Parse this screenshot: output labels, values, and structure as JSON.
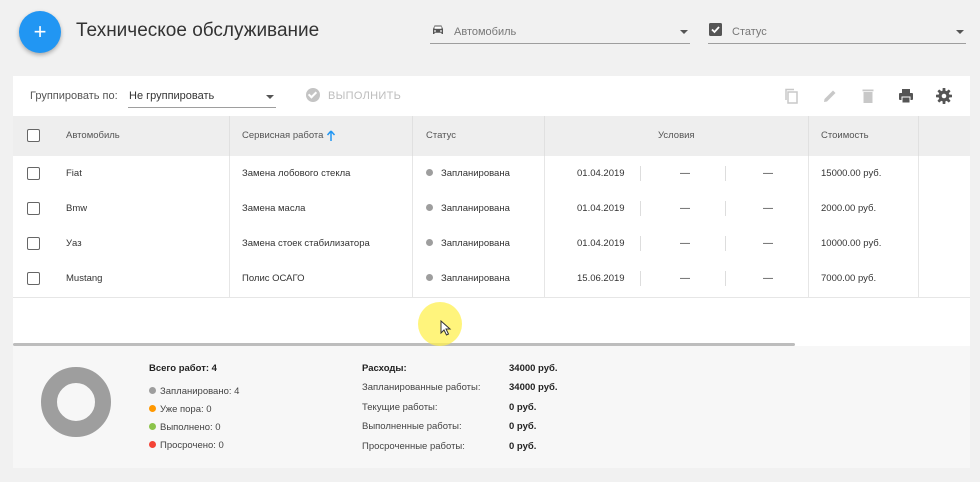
{
  "header": {
    "title": "Техническое обслуживание",
    "add_button": "+",
    "filters": [
      {
        "placeholder": "Автомобиль",
        "icon": "car-icon"
      },
      {
        "placeholder": "Статус",
        "icon": "checkbox-icon"
      }
    ]
  },
  "toolbar": {
    "group_label": "Группировать по:",
    "group_value": "Не группировать",
    "run_label": "ВЫПОЛНИТЬ",
    "icons": [
      "copy-icon",
      "edit-icon",
      "delete-icon",
      "print-icon",
      "settings-icon"
    ]
  },
  "table": {
    "columns": {
      "car": "Автомобиль",
      "service": "Сервисная работа",
      "status": "Статус",
      "conditions": "Условия",
      "cost": "Стоимость"
    },
    "rows": [
      {
        "car": "Fiat",
        "service": "Замена лобового стекла",
        "status": "Запланирована",
        "date": "01.04.2019",
        "c1": "—",
        "c2": "—",
        "cost": "15000.00 руб."
      },
      {
        "car": "Bmw",
        "service": "Замена масла",
        "status": "Запланирована",
        "date": "01.04.2019",
        "c1": "—",
        "c2": "—",
        "cost": "2000.00 руб."
      },
      {
        "car": "Уаз",
        "service": "Замена стоек стабилизатора",
        "status": "Запланирована",
        "date": "01.04.2019",
        "c1": "—",
        "c2": "—",
        "cost": "10000.00 руб."
      },
      {
        "car": "Mustang",
        "service": "Полис ОСАГО",
        "status": "Запланирована",
        "date": "15.06.2019",
        "c1": "—",
        "c2": "—",
        "cost": "7000.00 руб."
      }
    ]
  },
  "summary": {
    "total": "Всего работ: 4",
    "legend": [
      {
        "label": "Запланировано: 4",
        "color": "#9e9e9e"
      },
      {
        "label": "Уже пора: 0",
        "color": "#ff9800"
      },
      {
        "label": "Выполнено: 0",
        "color": "#8bc34a"
      },
      {
        "label": "Просрочено: 0",
        "color": "#f44336"
      }
    ],
    "expenses": [
      {
        "label": "Расходы:",
        "value": "34000 руб."
      },
      {
        "label": "Запланированные работы:",
        "value": "34000 руб."
      },
      {
        "label": "Текущие работы:",
        "value": "0 руб."
      },
      {
        "label": "Выполненные работы:",
        "value": "0 руб."
      },
      {
        "label": "Просроченные работы:",
        "value": "0 руб."
      }
    ]
  },
  "colors": {
    "accent": "#2196f3",
    "planned": "#9e9e9e"
  }
}
